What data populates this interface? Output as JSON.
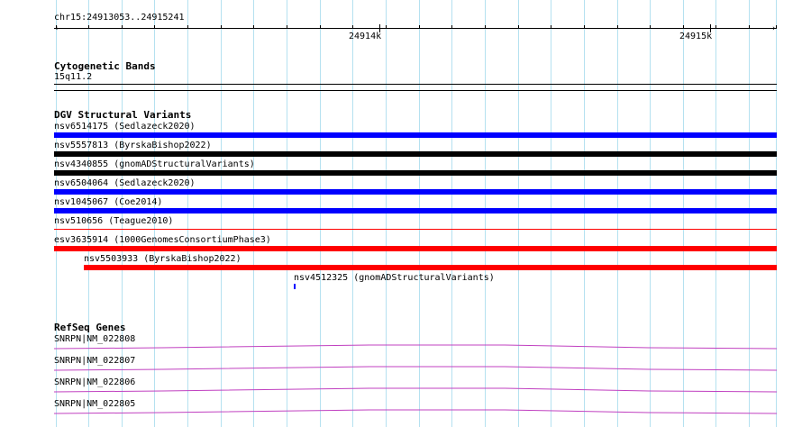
{
  "ruler": {
    "location": "chr15:24913053..24915241",
    "major_labels": [
      "24914k",
      "24915k"
    ]
  },
  "cytoband": {
    "title": "Cytogenetic Bands",
    "band": "15q11.2"
  },
  "dgv": {
    "title": "DGV Structural Variants",
    "features": [
      {
        "label": "nsv6514175 (Sedlazeck2020)",
        "color": "#0000ff"
      },
      {
        "label": "nsv5557813 (ByrskaBishop2022)",
        "color": "#000000"
      },
      {
        "label": "nsv4340855 (gnomADStructuralVariants)",
        "color": "#000000"
      },
      {
        "label": "nsv6504064 (Sedlazeck2020)",
        "color": "#0000ff"
      },
      {
        "label": "nsv1045067 (Coe2014)",
        "color": "#0000ff"
      },
      {
        "label": "nsv510656 (Teague2010)",
        "color": "#ff0000"
      },
      {
        "label": "esv3635914 (1000GenomesConsortiumPhase3)",
        "color": "#ff0000"
      },
      {
        "label": "nsv5503933 (ByrskaBishop2022)",
        "color": "#ff0000"
      },
      {
        "label": "nsv4512325 (gnomADStructuralVariants)",
        "color": "#0000ff"
      }
    ]
  },
  "refseq": {
    "title": "RefSeq Genes",
    "genes": [
      {
        "label": "SNRPN|NM_022808",
        "color": "#c040c0"
      },
      {
        "label": "SNRPN|NM_022807",
        "color": "#c040c0"
      },
      {
        "label": "SNRPN|NM_022806",
        "color": "#c040c0"
      },
      {
        "label": "SNRPN|NM_022805",
        "color": "#c040c0"
      }
    ]
  }
}
